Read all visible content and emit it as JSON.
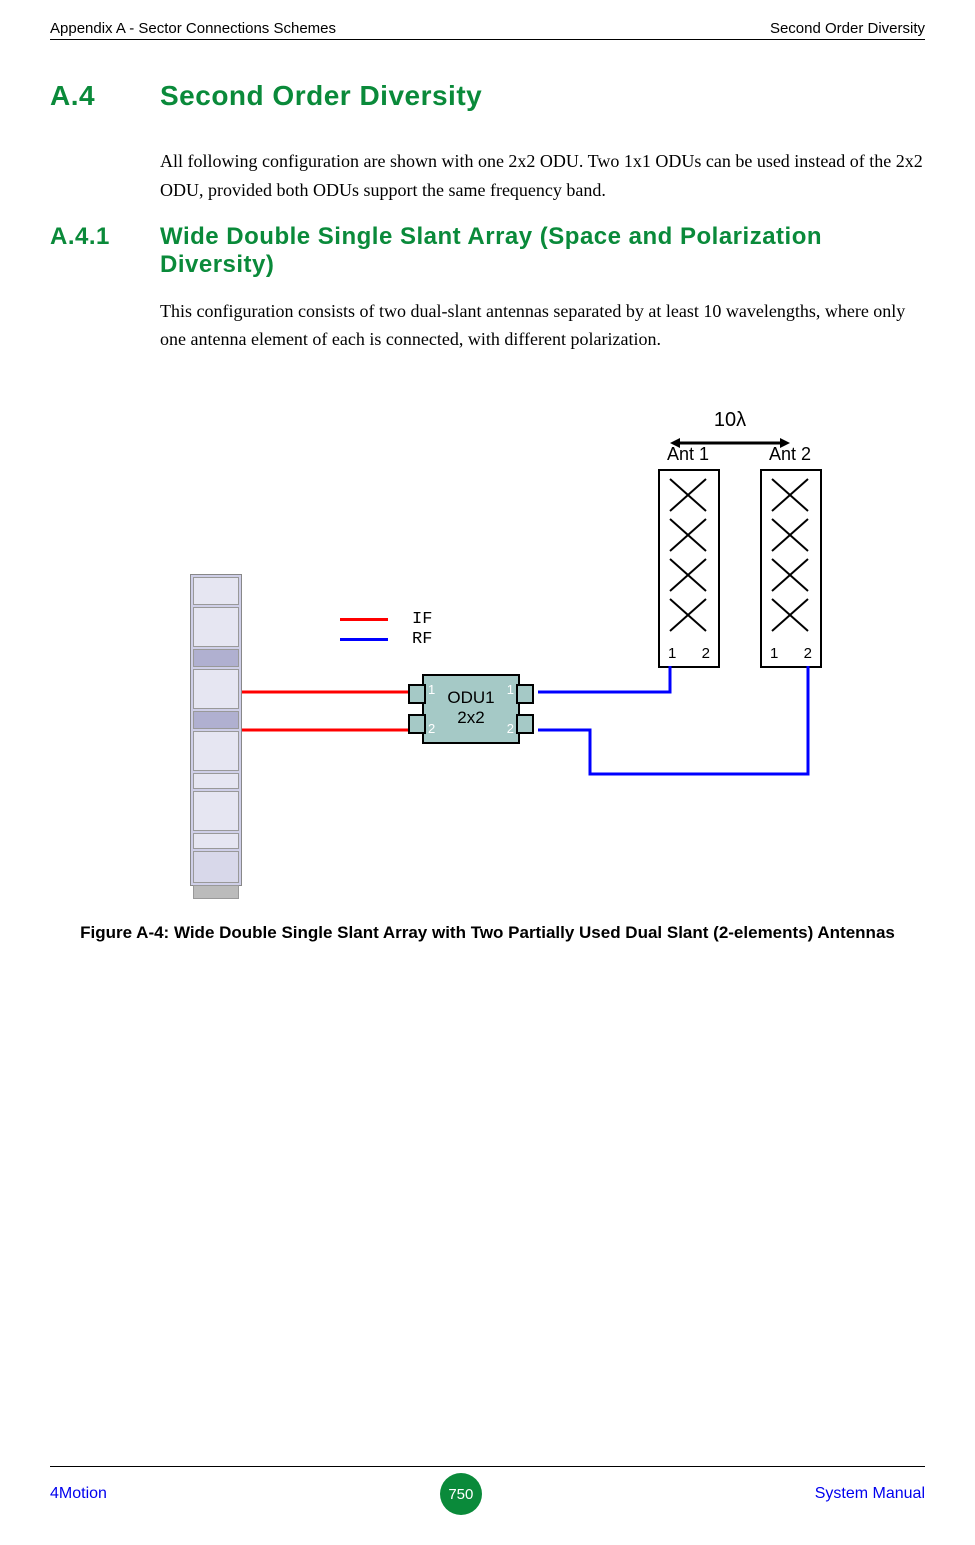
{
  "header": {
    "left": "Appendix A - Sector Connections Schemes",
    "right": "Second Order Diversity"
  },
  "section": {
    "number": "A.4",
    "title": "Second Order Diversity",
    "intro": "All following configuration are shown with one 2x2 ODU. Two 1x1 ODUs can be used instead of the 2x2 ODU, provided both ODUs support the same frequency band."
  },
  "subsection": {
    "number": "A.4.1",
    "title": "Wide Double Single Slant Array (Space and Polarization Diversity)",
    "body": "This configuration consists of two dual-slant antennas separated by at least 10 wavelengths, where only one antenna element of each is connected, with different polarization."
  },
  "diagram": {
    "separation": "10λ",
    "ant1_label": "Ant 1",
    "ant2_label": "Ant 2",
    "ant_port1": "1",
    "ant_port2": "2",
    "odu_line1": "ODU1",
    "odu_line2": "2x2",
    "odu_port1": "1",
    "odu_port2": "2",
    "legend_if": "IF",
    "legend_rf": "RF"
  },
  "figure_caption": "Figure A-4: Wide Double Single Slant Array with Two Partially Used Dual Slant (2-elements) Antennas",
  "footer": {
    "left": "4Motion",
    "page": "750",
    "right": "System Manual"
  }
}
